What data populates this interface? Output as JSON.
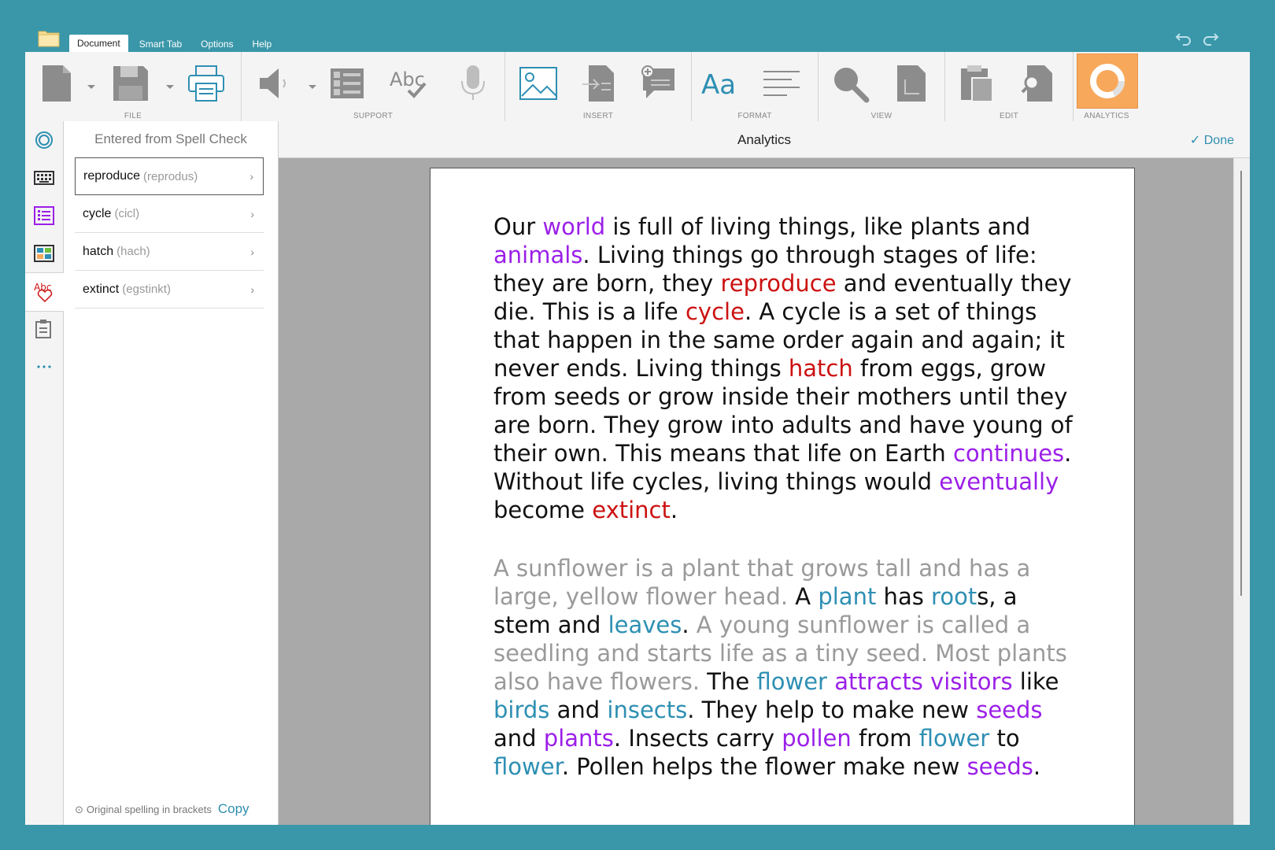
{
  "menu": {
    "tabs": [
      "Document",
      "Smart Tab",
      "Options",
      "Help"
    ],
    "active_tab": "Document"
  },
  "ribbon": {
    "groups": {
      "file": "FILE",
      "support": "SUPPORT",
      "insert": "INSERT",
      "format": "FORMAT",
      "view": "VIEW",
      "edit": "EDIT",
      "analytics": "ANALYTICS"
    }
  },
  "panel": {
    "title": "Entered from Spell Check",
    "items": [
      {
        "word": "reproduce",
        "orig": "(reprodus)"
      },
      {
        "word": "cycle",
        "orig": "(cicl)"
      },
      {
        "word": "hatch",
        "orig": "(hach)"
      },
      {
        "word": "extinct",
        "orig": "(egstinkt)"
      }
    ],
    "footer_note": "Original spelling in brackets",
    "copy_label": "Copy"
  },
  "doc_header": {
    "title": "Analytics",
    "done_label": "Done"
  },
  "document": {
    "paragraphs": [
      [
        {
          "t": "Our ",
          "c": "n"
        },
        {
          "t": "world",
          "c": "p"
        },
        {
          "t": " is full of living things, like plants and ",
          "c": "n"
        },
        {
          "t": "animals",
          "c": "p"
        },
        {
          "t": ". Living things go through stages of life: they are born, they ",
          "c": "n"
        },
        {
          "t": "reproduce",
          "c": "r"
        },
        {
          "t": " and eventually they die. This is a life ",
          "c": "n"
        },
        {
          "t": "cycle",
          "c": "r"
        },
        {
          "t": ". A cycle is a set of things that happen in the same order again and again; it never ends. Living things ",
          "c": "n"
        },
        {
          "t": "hatch",
          "c": "r"
        },
        {
          "t": " from eggs, grow from seeds or grow inside their mothers until they are born. They grow into adults and have young of their own. This means that life on Earth ",
          "c": "n"
        },
        {
          "t": "continues",
          "c": "p"
        },
        {
          "t": ". Without life cycles, living things would ",
          "c": "n"
        },
        {
          "t": "eventually",
          "c": "p"
        },
        {
          "t": " become ",
          "c": "n"
        },
        {
          "t": "extinct",
          "c": "r"
        },
        {
          "t": ".",
          "c": "n"
        }
      ],
      [
        {
          "t": "A sunflower is a plant that grows tall and has a large, yellow flower head.",
          "c": "g"
        },
        {
          "t": " A ",
          "c": "n"
        },
        {
          "t": "plant",
          "c": "b"
        },
        {
          "t": " has ",
          "c": "n"
        },
        {
          "t": "root",
          "c": "b"
        },
        {
          "t": "s, a stem and ",
          "c": "n"
        },
        {
          "t": "leaves",
          "c": "b"
        },
        {
          "t": ".",
          "c": "n"
        },
        {
          "t": " A young sunflower is called a seedling and starts life as a tiny seed. Most plants also have flowers.",
          "c": "g"
        },
        {
          "t": " The ",
          "c": "n"
        },
        {
          "t": "flower",
          "c": "b"
        },
        {
          "t": " ",
          "c": "n"
        },
        {
          "t": "attracts",
          "c": "p"
        },
        {
          "t": " ",
          "c": "n"
        },
        {
          "t": "visitors",
          "c": "p"
        },
        {
          "t": " like ",
          "c": "n"
        },
        {
          "t": "birds",
          "c": "b"
        },
        {
          "t": " and ",
          "c": "n"
        },
        {
          "t": "insects",
          "c": "b"
        },
        {
          "t": ". They help to make new ",
          "c": "n"
        },
        {
          "t": "seeds",
          "c": "p"
        },
        {
          "t": " and ",
          "c": "n"
        },
        {
          "t": "plants",
          "c": "p"
        },
        {
          "t": ". Insects carry ",
          "c": "n"
        },
        {
          "t": "pollen",
          "c": "p"
        },
        {
          "t": " from ",
          "c": "n"
        },
        {
          "t": "flower",
          "c": "b"
        },
        {
          "t": " to ",
          "c": "n"
        },
        {
          "t": "flower",
          "c": "b"
        },
        {
          "t": ". Pollen helps the flower make new ",
          "c": "n"
        },
        {
          "t": "seeds",
          "c": "p"
        },
        {
          "t": ".",
          "c": "n"
        }
      ]
    ]
  },
  "colors": {
    "background": "#3a97a9",
    "accent_blue": "#2e8fb3",
    "purple": "#9b1fe8",
    "red": "#cc1111",
    "grey_text": "#9a9a9a",
    "analytics_active": "#f7a85b"
  }
}
